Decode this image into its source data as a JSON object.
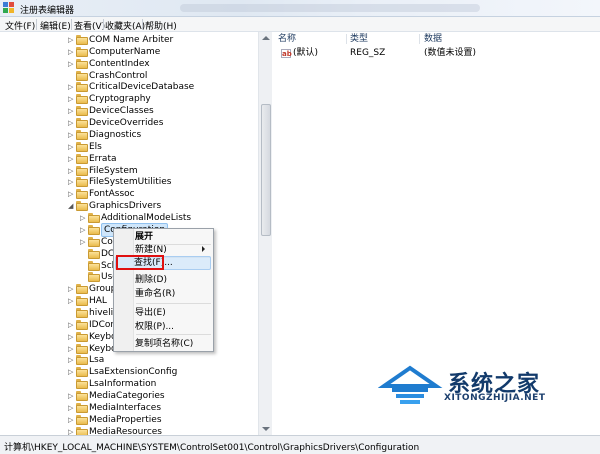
{
  "window": {
    "title": "注册表编辑器"
  },
  "menu": [
    "文件(F)",
    "编辑(E)",
    "查看(V)",
    "收藏夹(A)",
    "帮助(H)"
  ],
  "tree": [
    {
      "label": "COM Name Arbiter",
      "exp": "▷"
    },
    {
      "label": "ComputerName",
      "exp": "▷"
    },
    {
      "label": "ContentIndex",
      "exp": "▷"
    },
    {
      "label": "CrashControl",
      "exp": ""
    },
    {
      "label": "CriticalDeviceDatabase",
      "exp": "▷"
    },
    {
      "label": "Cryptography",
      "exp": "▷"
    },
    {
      "label": "DeviceClasses",
      "exp": "▷"
    },
    {
      "label": "DeviceOverrides",
      "exp": "▷"
    },
    {
      "label": "Diagnostics",
      "exp": "▷"
    },
    {
      "label": "Els",
      "exp": "▷"
    },
    {
      "label": "Errata",
      "exp": "▷"
    },
    {
      "label": "FileSystem",
      "exp": "▷"
    },
    {
      "label": "FileSystemUtilities",
      "exp": "▷"
    },
    {
      "label": "FontAssoc",
      "exp": "▷"
    },
    {
      "label": "GraphicsDrivers",
      "exp": "◢",
      "expanded": true
    },
    {
      "label": "AdditionalModeLists",
      "exp": "▷",
      "child": true
    },
    {
      "label": "Configuration",
      "exp": "▷",
      "child": true,
      "selected": true
    },
    {
      "label": "Cor",
      "exp": "▷",
      "child": true
    },
    {
      "label": "DCI",
      "exp": "",
      "child": true
    },
    {
      "label": "Sch",
      "exp": "",
      "child": true
    },
    {
      "label": "Use",
      "exp": "",
      "child": true
    },
    {
      "label": "Group",
      "exp": "▷"
    },
    {
      "label": "HAL",
      "exp": "▷"
    },
    {
      "label": "hivelist",
      "exp": ""
    },
    {
      "label": "IDConfi",
      "exp": "▷"
    },
    {
      "label": "Keyboa",
      "exp": "▷"
    },
    {
      "label": "Keyboa",
      "exp": "▷"
    },
    {
      "label": "Lsa",
      "exp": "▷"
    },
    {
      "label": "LsaExtensionConfig",
      "exp": "▷"
    },
    {
      "label": "LsaInformation",
      "exp": ""
    },
    {
      "label": "MediaCategories",
      "exp": "▷"
    },
    {
      "label": "MediaInterfaces",
      "exp": "▷"
    },
    {
      "label": "MediaProperties",
      "exp": "▷"
    },
    {
      "label": "MediaResources",
      "exp": "▷"
    }
  ],
  "list": {
    "headers": {
      "name": "名称",
      "type": "类型",
      "data": "数据"
    },
    "rows": [
      {
        "icon": "ab",
        "name": "(默认)",
        "type": "REG_SZ",
        "data": "(数值未设置)"
      }
    ]
  },
  "context_menu": {
    "expand": "展开",
    "new": "新建(N)",
    "find": "查找(F)...",
    "delete": "删除(D)",
    "rename": "重命名(R)",
    "export": "导出(E)",
    "permissions": "权限(P)...",
    "copy_key_name": "复制项名称(C)"
  },
  "status": {
    "path": "计算机\\HKEY_LOCAL_MACHINE\\SYSTEM\\ControlSet001\\Control\\GraphicsDrivers\\Configuration"
  },
  "watermark": {
    "main": "系统之家",
    "sub": "XITONGZHIJIA.NET"
  }
}
